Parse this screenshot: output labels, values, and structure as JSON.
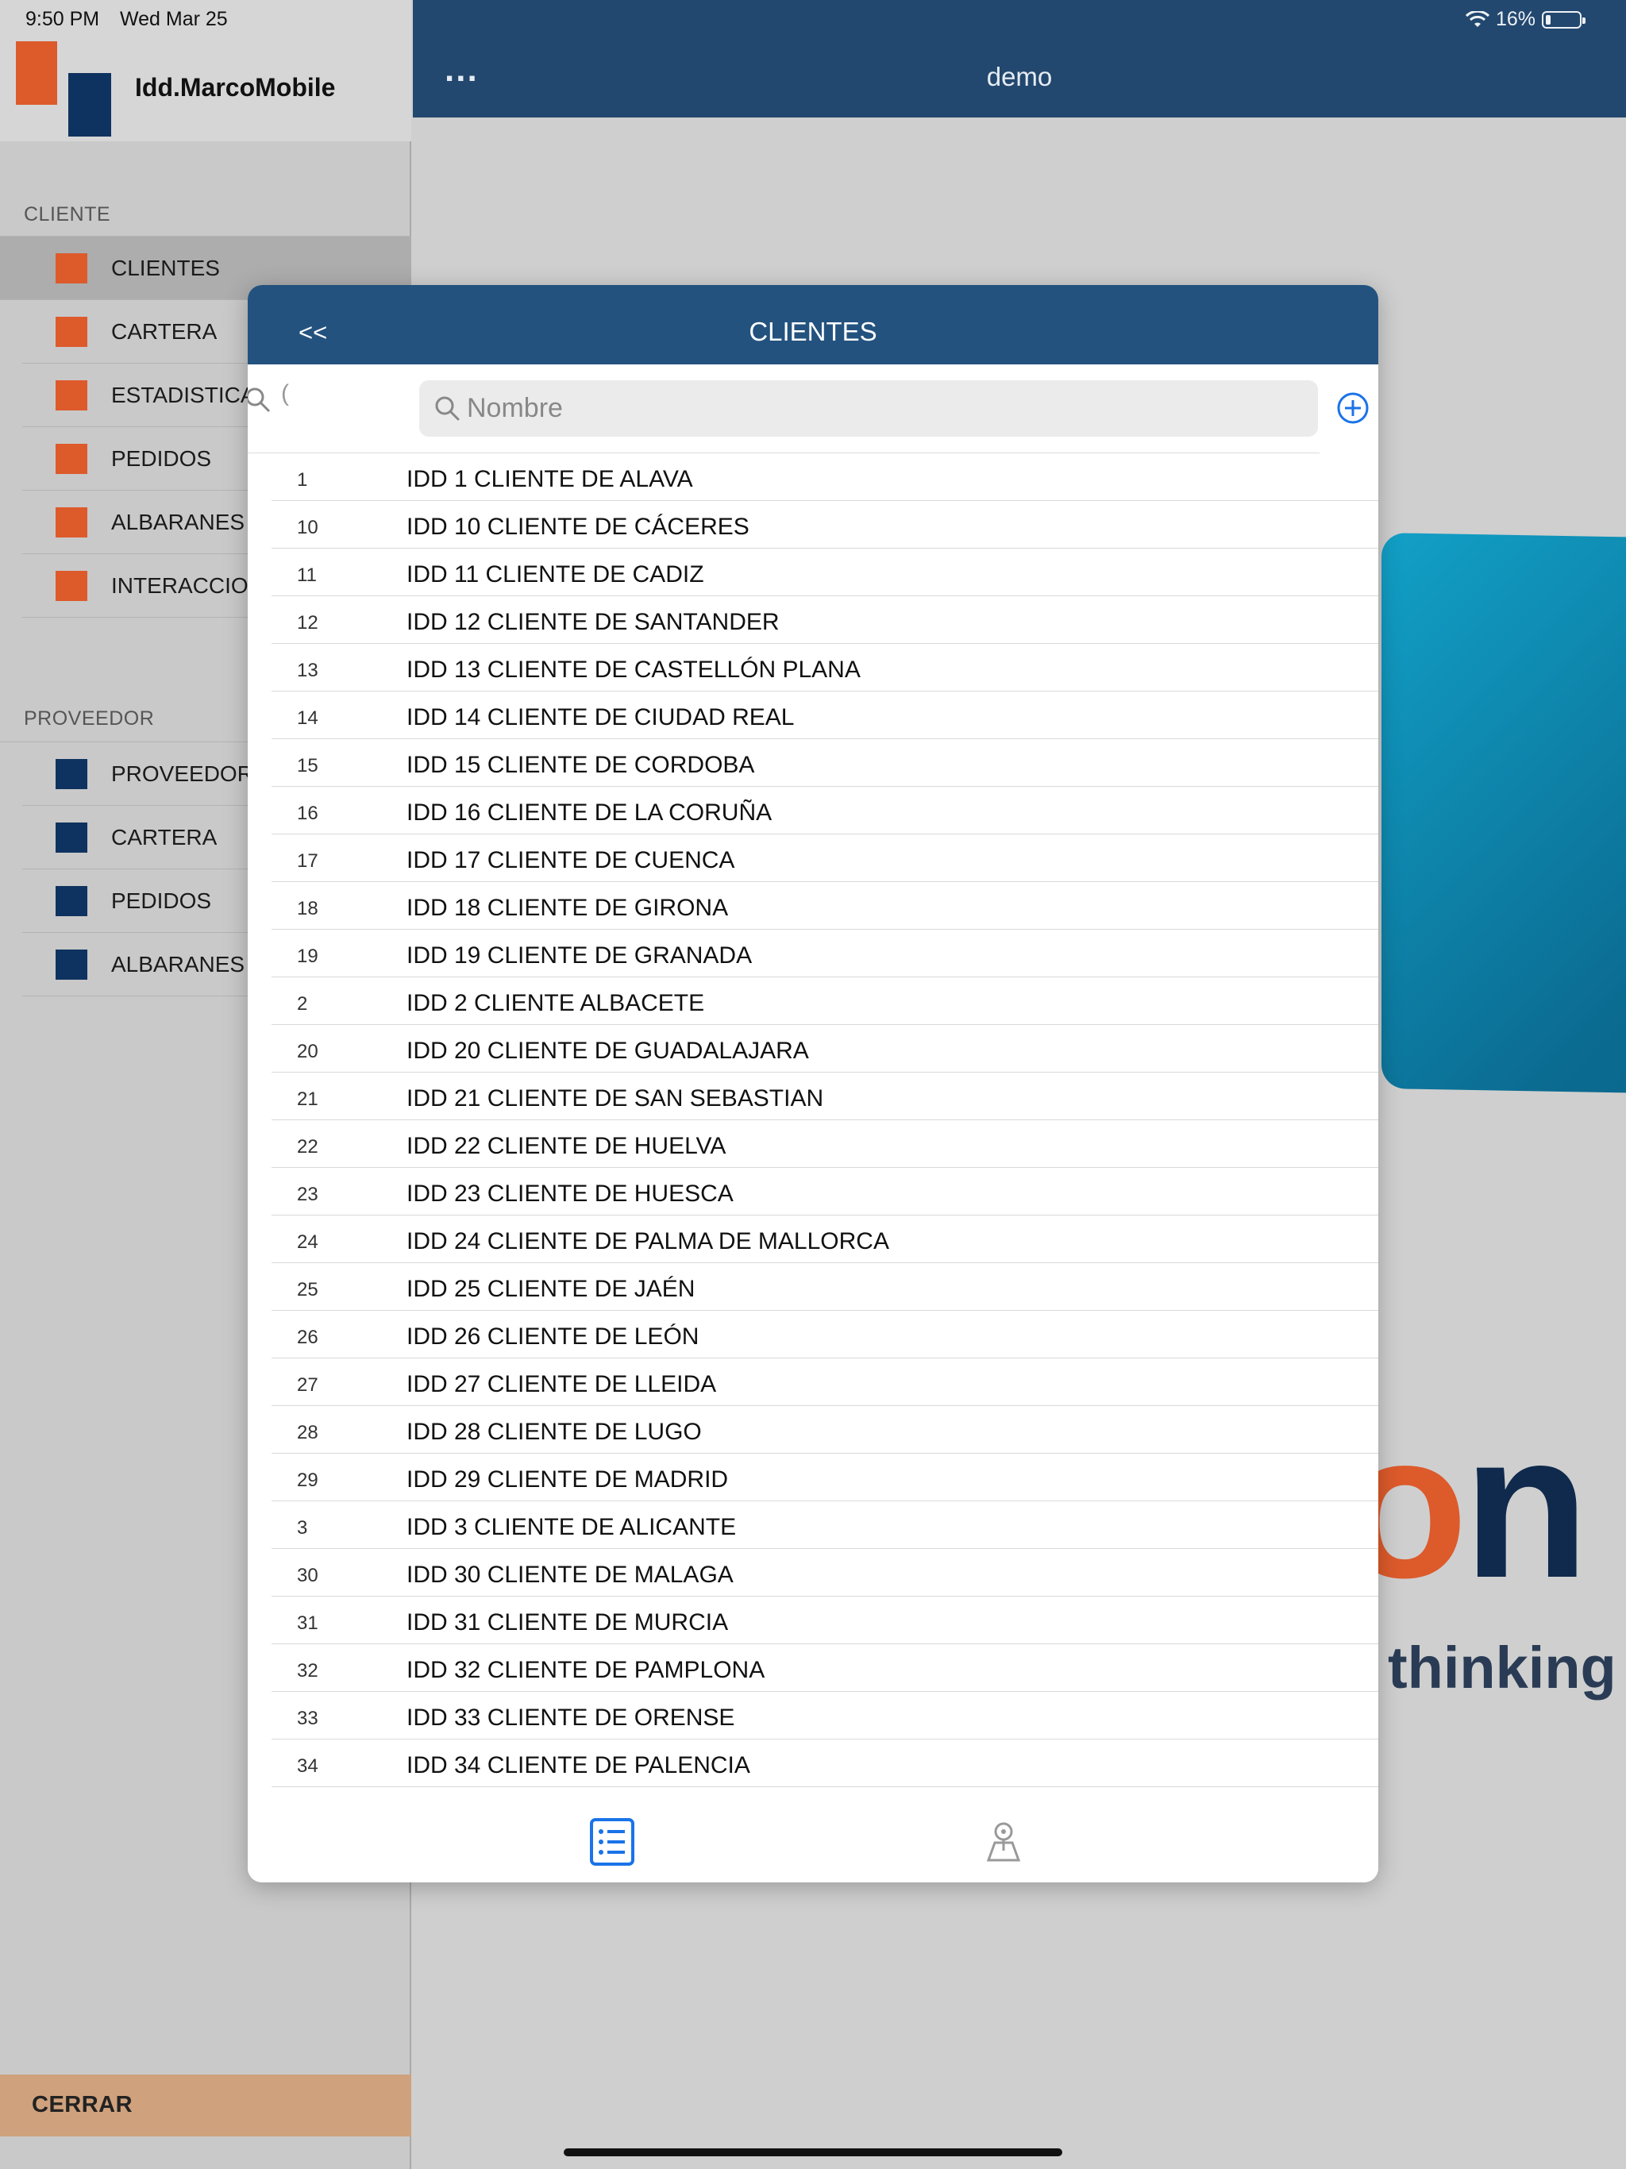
{
  "status_bar": {
    "time": "9:50 PM",
    "date": "Wed Mar 25",
    "battery": "16%"
  },
  "sidebar": {
    "app_name": "Idd.MarcoMobile",
    "cliente_section": {
      "label": "CLIENTE",
      "items": [
        {
          "label": "CLIENTES"
        },
        {
          "label": "CARTERA"
        },
        {
          "label": "ESTADISTICAS"
        },
        {
          "label": "PEDIDOS"
        },
        {
          "label": "ALBARANES"
        },
        {
          "label": "INTERACCIONES"
        }
      ]
    },
    "proveedor_section": {
      "label": "PROVEEDOR",
      "items": [
        {
          "label": "PROVEEDORES"
        },
        {
          "label": "CARTERA"
        },
        {
          "label": "PEDIDOS"
        },
        {
          "label": "ALBARANES"
        }
      ]
    },
    "close_label": "CERRAR",
    "colors": {
      "cliente": "#dd5a2b",
      "proveedor": "#0f3360"
    }
  },
  "main": {
    "title": "demo",
    "menu_glyph": "...",
    "background_logo": {
      "fragment_on_o": "o",
      "fragment_on_n": "n",
      "tagline_fragment": "thinking"
    }
  },
  "modal": {
    "title": "CLIENTES",
    "back_label": "<<",
    "search_placeholder": "Nombre",
    "left_search_fragment": "(",
    "rows": [
      {
        "code": "1",
        "name": "IDD 1 CLIENTE DE ALAVA"
      },
      {
        "code": "10",
        "name": "IDD 10 CLIENTE DE CÁCERES"
      },
      {
        "code": "11",
        "name": "IDD 11 CLIENTE DE CADIZ"
      },
      {
        "code": "12",
        "name": "IDD 12 CLIENTE DE SANTANDER"
      },
      {
        "code": "13",
        "name": "IDD 13 CLIENTE DE CASTELLÓN PLANA"
      },
      {
        "code": "14",
        "name": "IDD 14 CLIENTE DE CIUDAD REAL"
      },
      {
        "code": "15",
        "name": "IDD 15 CLIENTE DE CORDOBA"
      },
      {
        "code": "16",
        "name": "IDD 16 CLIENTE DE LA CORUÑA"
      },
      {
        "code": "17",
        "name": "IDD 17 CLIENTE DE CUENCA"
      },
      {
        "code": "18",
        "name": "IDD 18 CLIENTE DE GIRONA"
      },
      {
        "code": "19",
        "name": "IDD 19 CLIENTE DE GRANADA"
      },
      {
        "code": "2",
        "name": "IDD 2 CLIENTE ALBACETE"
      },
      {
        "code": "20",
        "name": "IDD 20 CLIENTE DE GUADALAJARA"
      },
      {
        "code": "21",
        "name": "IDD 21 CLIENTE DE SAN SEBASTIAN"
      },
      {
        "code": "22",
        "name": "IDD 22 CLIENTE DE HUELVA"
      },
      {
        "code": "23",
        "name": "IDD 23 CLIENTE DE HUESCA"
      },
      {
        "code": "24",
        "name": "IDD 24 CLIENTE DE PALMA DE MALLORCA"
      },
      {
        "code": "25",
        "name": "IDD 25 CLIENTE DE JAÉN"
      },
      {
        "code": "26",
        "name": "IDD 26 CLIENTE DE LEÓN"
      },
      {
        "code": "27",
        "name": "IDD 27 CLIENTE DE LLEIDA"
      },
      {
        "code": "28",
        "name": "IDD 28 CLIENTE DE LUGO"
      },
      {
        "code": "29",
        "name": "IDD 29 CLIENTE DE MADRID"
      },
      {
        "code": "3",
        "name": "IDD 3 CLIENTE DE ALICANTE"
      },
      {
        "code": "30",
        "name": "IDD 30 CLIENTE DE MALAGA"
      },
      {
        "code": "31",
        "name": "IDD 31 CLIENTE DE MURCIA"
      },
      {
        "code": "32",
        "name": "IDD 32 CLIENTE DE PAMPLONA"
      },
      {
        "code": "33",
        "name": "IDD 33 CLIENTE DE ORENSE"
      },
      {
        "code": "34",
        "name": "IDD 34 CLIENTE DE PALENCIA"
      }
    ],
    "tabs": [
      {
        "icon": "list-icon",
        "active": true
      },
      {
        "icon": "map-icon",
        "active": false
      }
    ],
    "accent_color": "#1a73e8",
    "header_color": "#23527f"
  }
}
